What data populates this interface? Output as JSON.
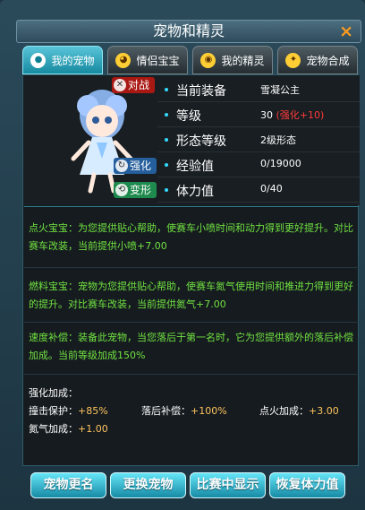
{
  "window": {
    "title": "宠物和精灵",
    "close_glyph": "×"
  },
  "tabs": [
    {
      "label": "我的宠物",
      "icon": "paw-icon",
      "active": true
    },
    {
      "label": "情侣宝宝",
      "icon": "baby-icon",
      "active": false
    },
    {
      "label": "我的精灵",
      "icon": "sprite-icon",
      "active": false
    },
    {
      "label": "宠物合成",
      "icon": "synthesis-icon",
      "active": false
    }
  ],
  "pet": {
    "actions": {
      "battle": "对战",
      "enhance": "强化",
      "transform": "变形"
    },
    "stats": [
      {
        "label": "当前装备",
        "value": "雪凝公主",
        "bonus": ""
      },
      {
        "label": "等级",
        "value": "30",
        "bonus": "(强化+10)"
      },
      {
        "label": "形态等级",
        "value": "2级形态",
        "bonus": ""
      },
      {
        "label": "经验值",
        "value": "0/19000",
        "bonus": ""
      },
      {
        "label": "体力值",
        "value": "0/40",
        "bonus": ""
      }
    ]
  },
  "descriptions": [
    "点火宝宝：为您提供贴心帮助，使赛车小喷时间和动力得到更好提升。对比赛车改装，当前提供小喷+7.00",
    "燃料宝宝：宠物为您提供贴心帮助，使赛车氮气使用时间和推进力得到更好的提升。对比赛车改装，当前提供氮气+7.00",
    "速度补偿：装备此宠物，当您落后于第一名时，它为您提供额外的落后补偿加成。当前等级加成150%"
  ],
  "enhancement": {
    "title": "强化加成：",
    "items": [
      {
        "label": "撞击保护：",
        "value": "+85%"
      },
      {
        "label": "落后补偿：",
        "value": "+100%"
      },
      {
        "label": "点火加成：",
        "value": "+3.00"
      },
      {
        "label": "氮气加成：",
        "value": "+1.00"
      }
    ]
  },
  "buttons": [
    "宠物更名",
    "更换宠物",
    "比赛中显示",
    "恢复体力值"
  ],
  "colors": {
    "accent": "#1aa7bd",
    "description": "#71e241",
    "bonus": "#ff3a3a",
    "value": "#ffc45e"
  }
}
